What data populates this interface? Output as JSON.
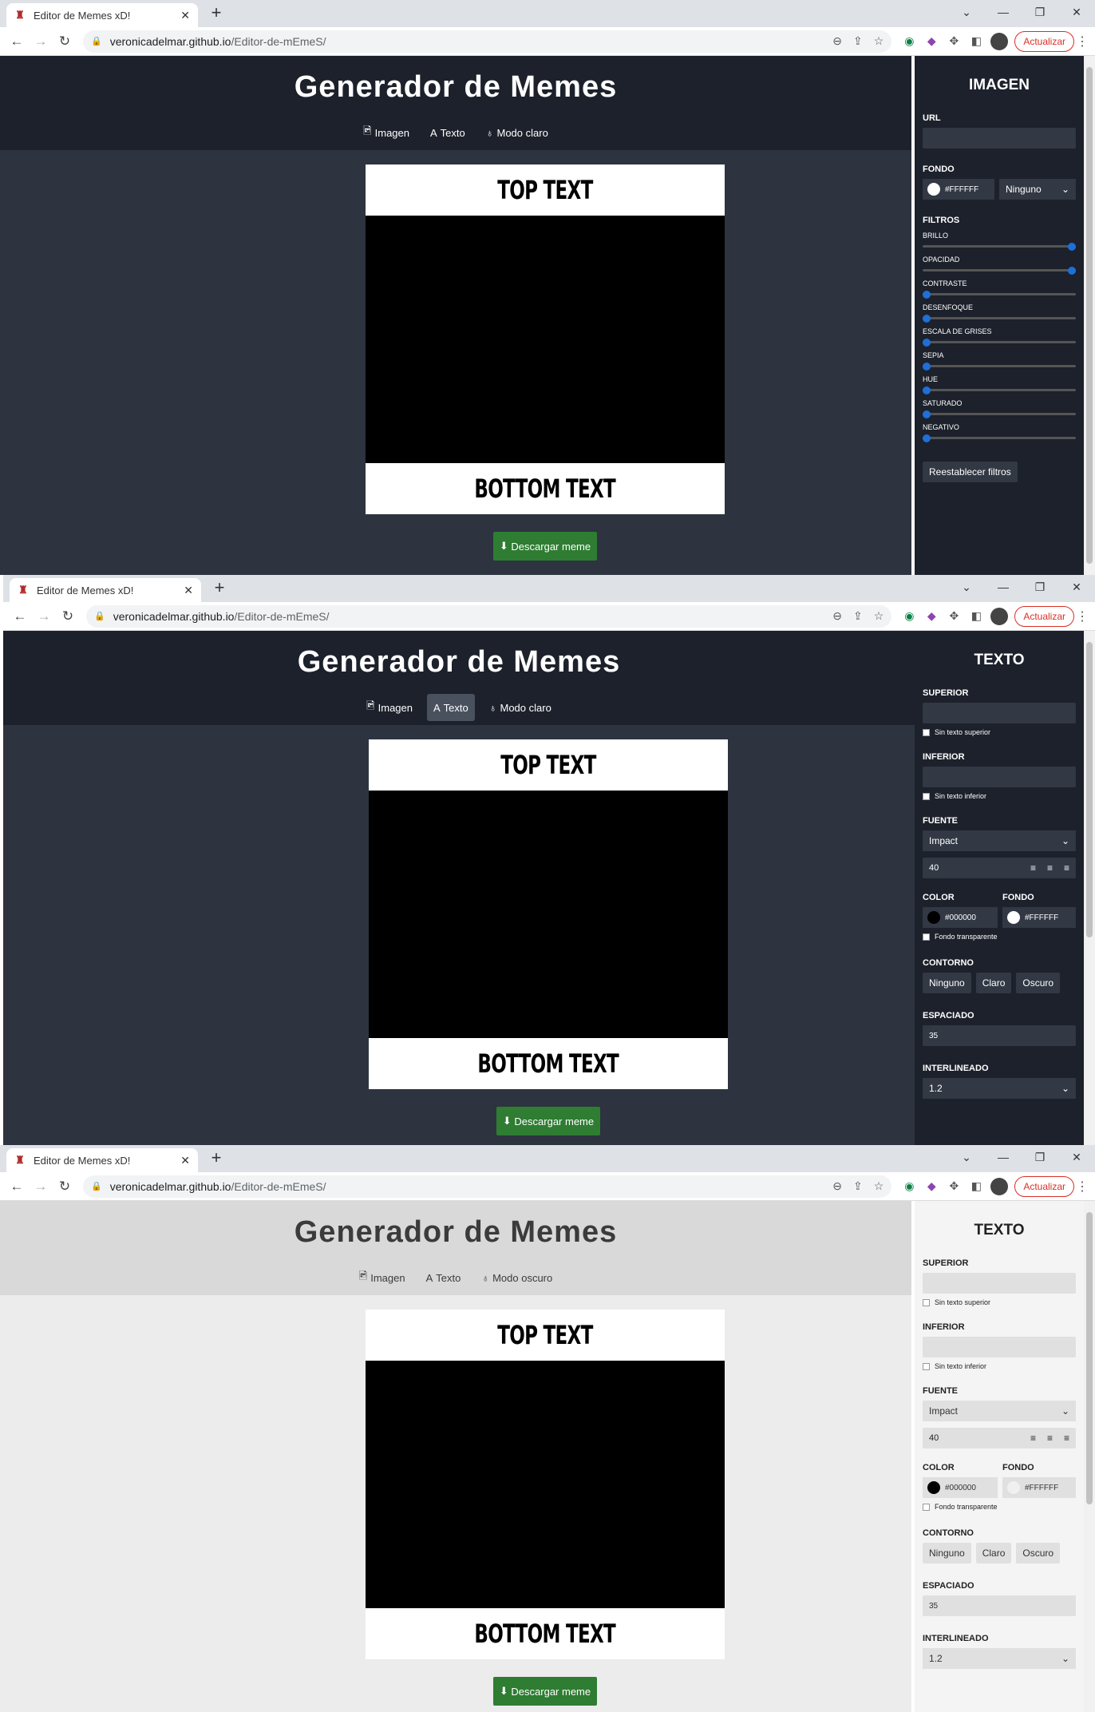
{
  "browser": {
    "tab_title": "Editor de Memes xD!",
    "tab_close": "✕",
    "new_tab": "+",
    "url_domain": "veronicadelmar.github.io",
    "url_path": "/Editor-de-mEmeS/",
    "update_label": "Actualizar",
    "win_min": "—",
    "win_restore": "❐",
    "win_close": "✕",
    "win_chevron": "⌄"
  },
  "app": {
    "title": "Generador de Memes",
    "nav_image": "Imagen",
    "nav_text": "Texto",
    "nav_light": "Modo claro",
    "nav_dark": "Modo oscuro",
    "top_text": "TOP TEXT",
    "bottom_text": "BOTTOM TEXT",
    "download": "Descargar meme"
  },
  "image_panel": {
    "heading": "IMAGEN",
    "url_label": "URL",
    "bg_label": "FONDO",
    "bg_color": "#FFFFFF",
    "blend_mode": "Ninguno",
    "filters_label": "FILTROS",
    "filters": [
      {
        "label": "BRILLO",
        "value": 1.0
      },
      {
        "label": "OPACIDAD",
        "value": 1.0
      },
      {
        "label": "CONTRASTE",
        "value": 0.0
      },
      {
        "label": "DESENFOQUE",
        "value": 0.0
      },
      {
        "label": "ESCALA DE GRISES",
        "value": 0.0
      },
      {
        "label": "SEPIA",
        "value": 0.0
      },
      {
        "label": "HUE",
        "value": 0.0
      },
      {
        "label": "SATURADO",
        "value": 0.0
      },
      {
        "label": "NEGATIVO",
        "value": 0.0
      }
    ],
    "reset": "Reestablecer filtros"
  },
  "text_panel": {
    "heading": "TEXTO",
    "top_label": "SUPERIOR",
    "no_top": "Sin texto superior",
    "bottom_label": "INFERIOR",
    "no_bottom": "Sin texto inferior",
    "font_label": "FUENTE",
    "font": "Impact",
    "size": "40",
    "color_label": "COLOR",
    "bg_label": "FONDO",
    "text_color": "#000000",
    "bg_color": "#FFFFFF",
    "transparent": "Fondo transparente",
    "outline_label": "CONTORNO",
    "outline_none": "Ninguno",
    "outline_light": "Claro",
    "outline_dark": "Oscuro",
    "spacing_label": "ESPACIADO",
    "spacing": "35",
    "line_label": "INTERLINEADO",
    "line": "1.2"
  },
  "colors": {
    "dark_bg": "#2d333f",
    "dark_header": "#1c212b",
    "light_bg": "#ececec",
    "light_header": "#d9d9d9",
    "download_green": "#2e7d32",
    "slider_blue": "#1e6fd9"
  }
}
